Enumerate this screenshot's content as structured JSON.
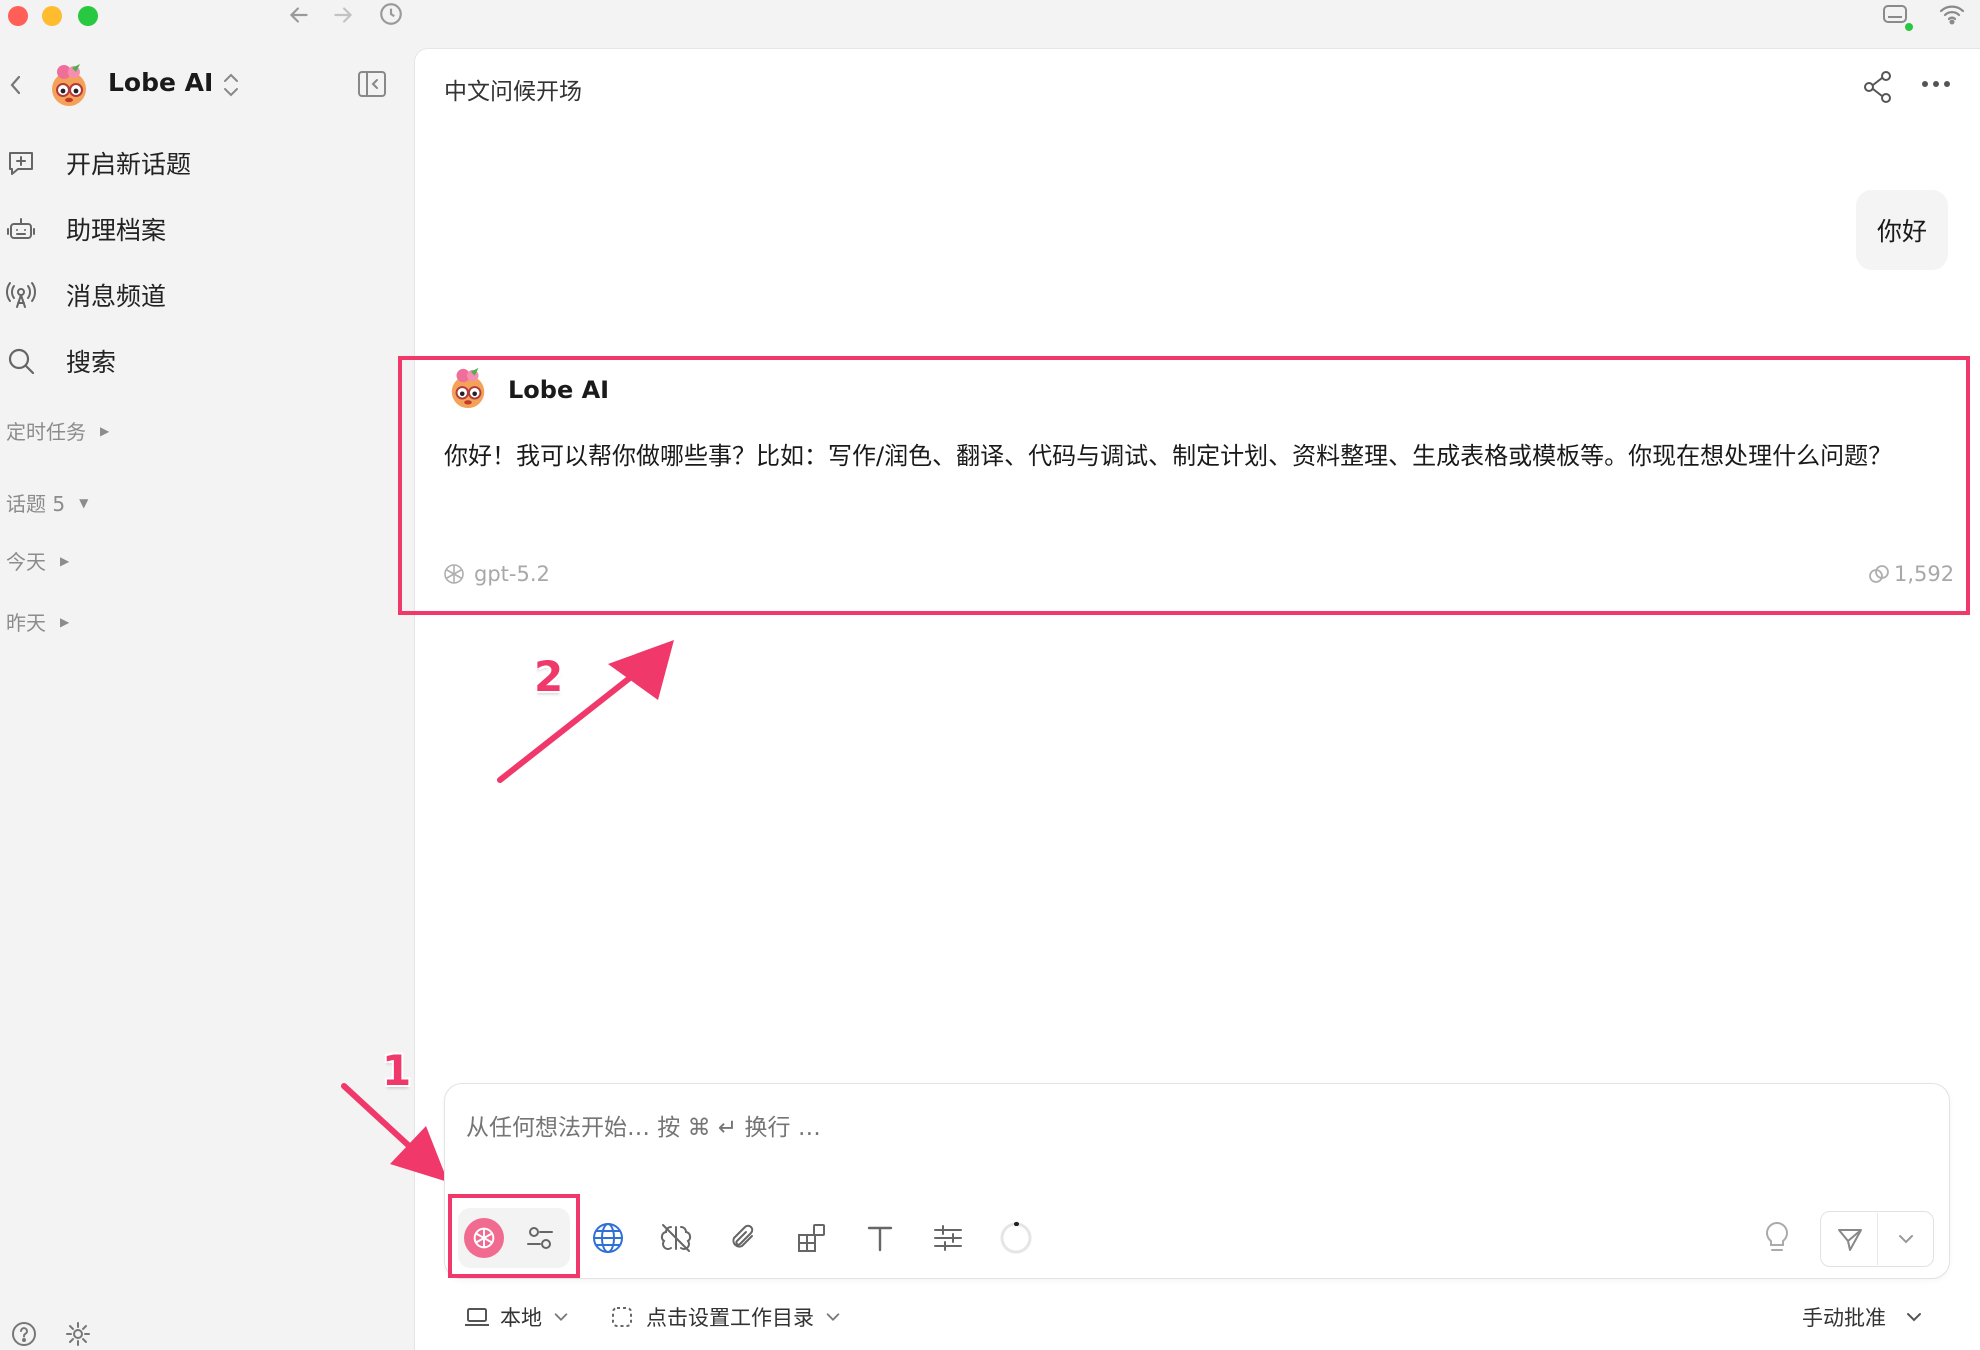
{
  "window": {
    "traffic_colors": [
      "#ff5f57",
      "#febc2e",
      "#28c840"
    ]
  },
  "sidebar": {
    "agent_name": "Lobe AI",
    "items": [
      {
        "label": "开启新话题",
        "icon": "new-topic-icon"
      },
      {
        "label": "助理档案",
        "icon": "robot-icon"
      },
      {
        "label": "消息频道",
        "icon": "broadcast-icon"
      },
      {
        "label": "搜索",
        "icon": "search-icon"
      }
    ],
    "sections": {
      "scheduled": "定时任务",
      "topics": "话题 5",
      "today": "今天",
      "yesterday": "昨天"
    }
  },
  "header": {
    "title": "中文问候开场"
  },
  "chat": {
    "user_message": "你好",
    "assistant": {
      "name": "Lobe AI",
      "message": "你好！我可以帮你做哪些事？比如：写作/润色、翻译、代码与调试、制定计划、资料整理、生成表格或模板等。你现在想处理什么问题？",
      "model": "gpt-5.2",
      "tokens": "1,592"
    }
  },
  "annotations": {
    "label_1": "1",
    "label_2": "2",
    "color": "#f0386b"
  },
  "input": {
    "placeholder": "从任何想法开始… 按 ⌘ ↵ 换行 …"
  },
  "footer": {
    "env": "本地",
    "workdir": "点击设置工作目录",
    "approval": "手动批准"
  }
}
